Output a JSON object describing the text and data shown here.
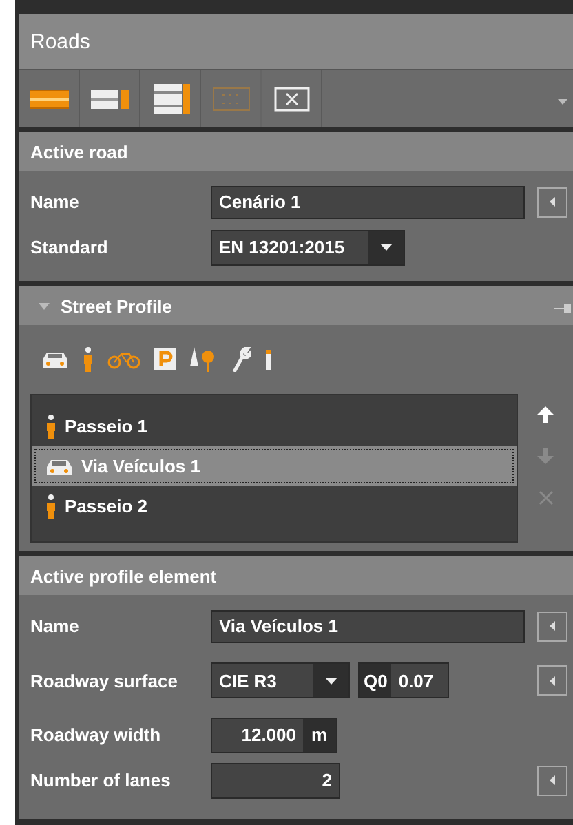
{
  "panel_title": "Roads",
  "toolbar": [
    {
      "kind": "road",
      "disabled": false
    },
    {
      "kind": "road-sidewalk",
      "disabled": false
    },
    {
      "kind": "road-double",
      "disabled": false
    },
    {
      "kind": "grid",
      "disabled": true
    },
    {
      "kind": "delete",
      "disabled": false
    }
  ],
  "active_road": {
    "title": "Active road",
    "fields": [
      {
        "kind": "text",
        "label": "Name",
        "value": "Cenário 1",
        "reset": true
      },
      {
        "kind": "select",
        "label": "Standard",
        "value": "EN 13201:2015",
        "reset": false
      }
    ]
  },
  "street_profile": {
    "title": "Street Profile",
    "expanded": true,
    "elements": [
      {
        "kind": "sidewalk",
        "label": "Passeio 1",
        "selected": false
      },
      {
        "kind": "roadway",
        "label": "Via Veículos 1",
        "selected": true
      },
      {
        "kind": "sidewalk",
        "label": "Passeio 2",
        "selected": false
      }
    ],
    "actions": [
      {
        "kind": "up",
        "disabled": false
      },
      {
        "kind": "down",
        "disabled": true
      },
      {
        "kind": "delete",
        "disabled": true
      }
    ]
  },
  "active_element": {
    "title": "Active profile element",
    "fields": [
      {
        "kind": "text",
        "label": "Name",
        "value": "Via Veículos 1",
        "reset": true
      },
      {
        "kind": "select",
        "label": "Roadway surface",
        "value": "CIE R3",
        "extra_label": "Q0",
        "extra_value": "0.07",
        "reset": true
      },
      {
        "kind": "number",
        "label": "Roadway width",
        "value": "12.000",
        "unit": "m",
        "reset": false
      },
      {
        "kind": "number",
        "label": "Number of lanes",
        "value": "2",
        "reset": true
      }
    ]
  }
}
